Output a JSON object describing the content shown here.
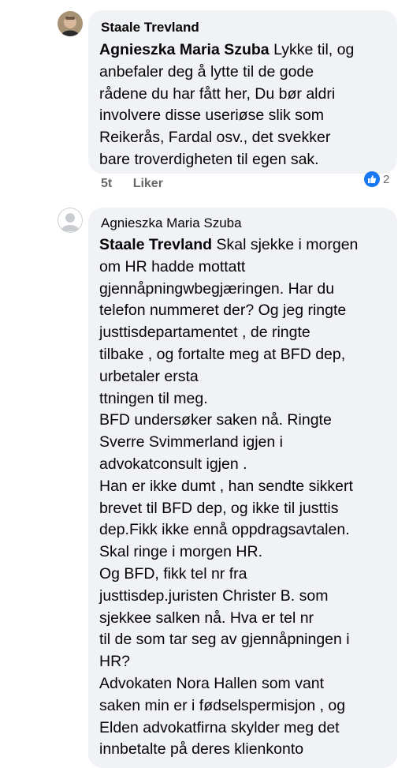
{
  "comment_1": {
    "author": "Staale Trevland",
    "mention": "Agnieszka Maria Szuba",
    "text_first_line": " Lykke til, og",
    "lines": [
      "anbefaler deg å lytte til de gode",
      "rådene du har fått her, Du bør aldri",
      "involvere disse useriøse slik som",
      "Reikerås, Fardal osv., det svekker",
      "bare troverdigheten til egen sak."
    ],
    "time": "5t",
    "like_label": "Liker",
    "reaction_count": "2"
  },
  "comment_2": {
    "author": "Agnieszka Maria Szuba",
    "mention": "Staale Trevland",
    "text_first_line": " Skal sjekke i morgen",
    "lines": [
      "om HR hadde mottatt",
      "gjennåpningwbegjæringen. Har  du",
      "telefon nummeret der? Og jeg ringte",
      "justtisdepartamentet , de ringte",
      "tilbake , og fortalte meg at BFD dep,",
      "urbetaler ersta",
      "ttningen til meg.",
      "BFD undersøker saken  nå. Ringte",
      "Sverre Svimmerland igjen i",
      "advokatconsult igjen .",
      "Han er ikke dumt , han sendte sikkert",
      "brevet til BFD dep, og ikke til justtis",
      "dep.Fikk ikke ennå oppdragsavtalen.",
      "Skal ringe i morgen HR.",
      "Og BFD, fikk tel nr fra",
      "justtisdep.juristen Christer B. som",
      "sjekkee salken nå. Hva er tel nr",
      "til de som tar seg av gjennåpningen i",
      "HR?",
      "Advokaten Nora Hallen som vant",
      "saken min er i  fødselspermisjon , og",
      "Elden advokatfirna skylder meg det",
      "innbetalte på deres klienkonto"
    ]
  }
}
